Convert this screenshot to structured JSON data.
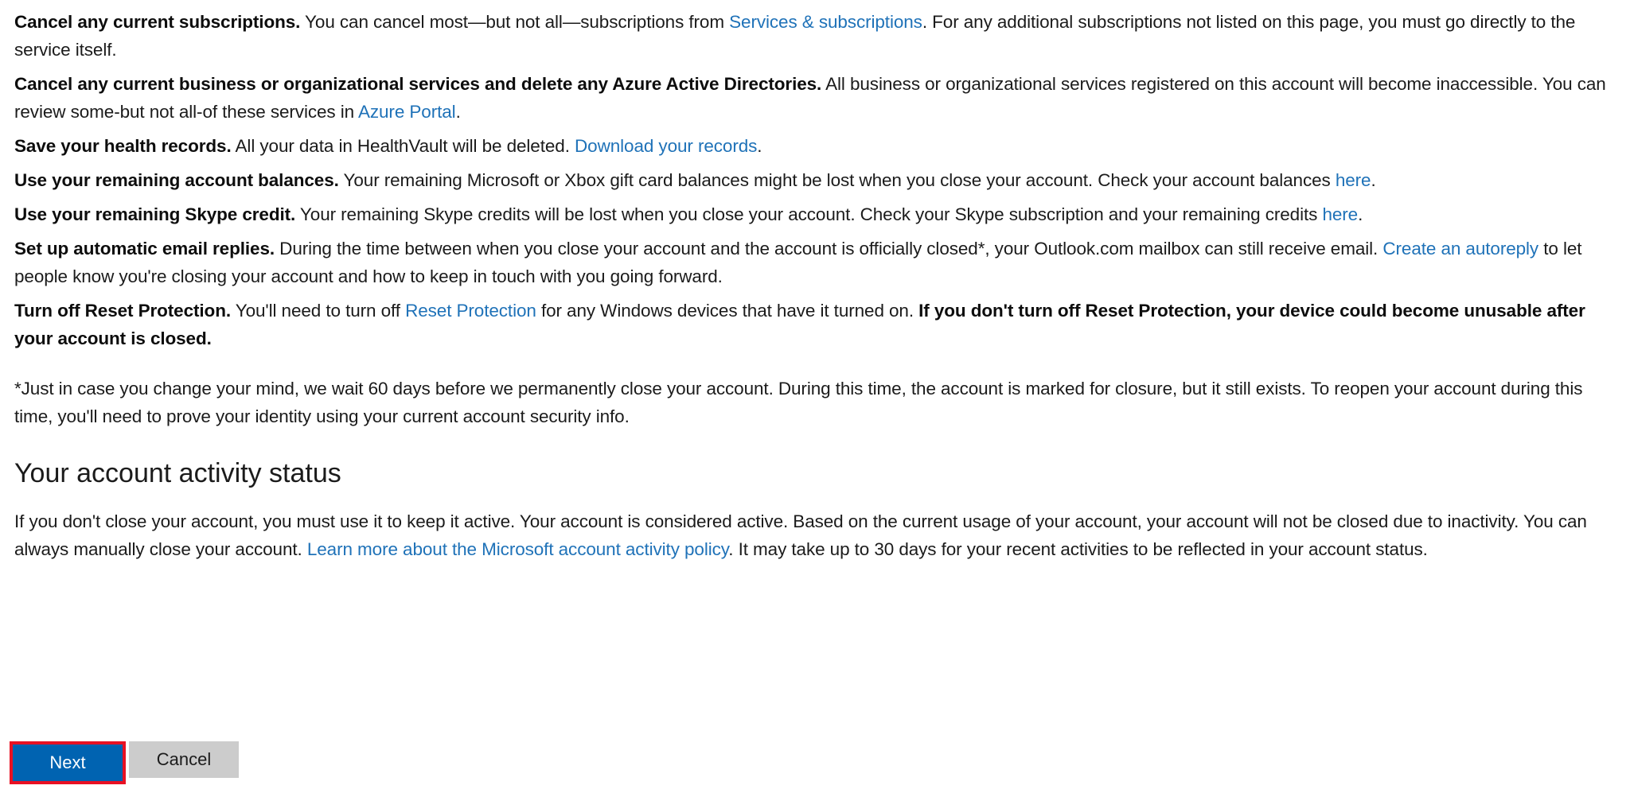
{
  "page": {
    "bullets": [
      {
        "id": "cancel-subscriptions",
        "lead": "Cancel any current subscriptions.",
        "text_1": " You can cancel most—but not all—subscriptions from ",
        "link_1": "Services & subscriptions",
        "text_2": ". For any additional subscriptions not listed on this page, you must go directly to the service itself."
      },
      {
        "id": "cancel-business-services",
        "lead": "Cancel any current business or organizational services and delete any Azure Active Directories.",
        "text_1": " All business or organizational services registered on this account will become inaccessible. You can review some-but not all-of these services in ",
        "link_1": "Azure Portal",
        "text_2": "."
      },
      {
        "id": "save-health-records",
        "lead": "Save your health records.",
        "text_1": " All your data in HealthVault will be deleted. ",
        "link_1": "Download your records",
        "text_2": "."
      },
      {
        "id": "use-account-balances",
        "lead": "Use your remaining account balances.",
        "text_1": " Your remaining Microsoft or Xbox gift card balances might be lost when you close your account. Check your account balances ",
        "link_1": "here",
        "text_2": "."
      },
      {
        "id": "use-skype-credit",
        "lead": "Use your remaining Skype credit.",
        "text_1": " Your remaining Skype credits will be lost when you close your account. Check your Skype subscription and your remaining credits ",
        "link_1": "here",
        "text_2": "."
      },
      {
        "id": "automatic-email-replies",
        "lead": "Set up automatic email replies.",
        "text_1": " During the time between when you close your account and the account is officially closed*, your Outlook.com mailbox can still receive email. ",
        "link_1": "Create an autoreply",
        "text_2": " to let people know you're closing your account and how to keep in touch with you going forward."
      },
      {
        "id": "turn-off-reset-protection",
        "lead": "Turn off Reset Protection.",
        "text_1": " You'll need to turn off ",
        "link_1": "Reset Protection",
        "text_2": " for any Windows devices that have it turned on. ",
        "strong_tail": "If you don't turn off Reset Protection, your device could become unusable after your account is closed."
      }
    ],
    "footnote": "*Just in case you change your mind, we wait 60 days before we permanently close your account. During this time, the account is marked for closure, but it still exists. To reopen your account during this time, you'll need to prove your identity using your current account security info.",
    "activity_section": {
      "heading": "Your account activity status",
      "text_1": "If you don't close your account, you must use it to keep it active. Your account is considered active. Based on the current usage of your account, your account will not be closed due to inactivity. You can always manually close your account. ",
      "link_1": "Learn more about the Microsoft account activity policy",
      "text_2": ". It may take up to 30 days for your recent activities to be reflected in your account status."
    },
    "actions": {
      "next_label": "Next",
      "cancel_label": "Cancel",
      "next_color": "#0063b1",
      "cancel_color": "#cccccc",
      "highlight_color": "#e81123",
      "link_color": "#1f72b8"
    }
  }
}
